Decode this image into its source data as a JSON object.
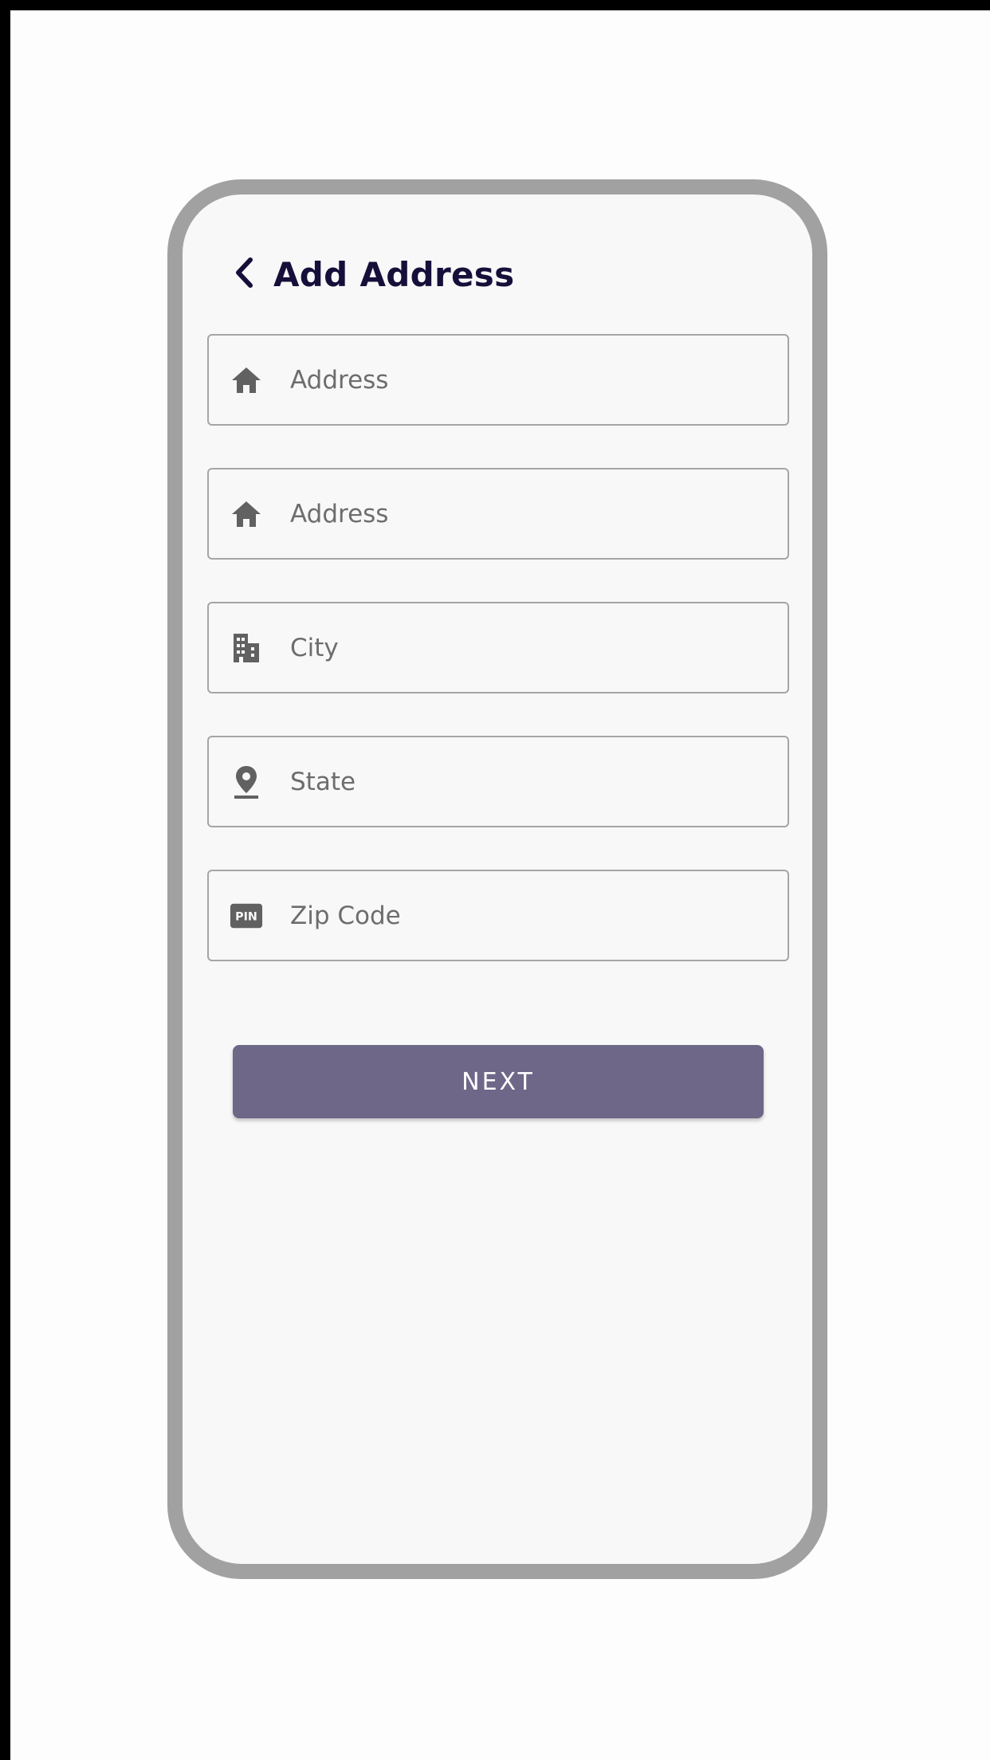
{
  "header": {
    "back_icon": "chevron-left-icon",
    "title": "Add Address"
  },
  "fields": [
    {
      "icon": "home-icon",
      "placeholder": "Address",
      "value": ""
    },
    {
      "icon": "home-icon",
      "placeholder": "Address",
      "value": ""
    },
    {
      "icon": "city-icon",
      "placeholder": "City",
      "value": ""
    },
    {
      "icon": "location-pin-icon",
      "placeholder": "State",
      "value": ""
    },
    {
      "icon": "pin-badge-icon",
      "placeholder": "Zip Code",
      "value": "",
      "icon_text": "PIN"
    }
  ],
  "next_button": {
    "label": "NEXT"
  },
  "colors": {
    "title": "#160f3a",
    "button": "#6e6788",
    "frame": "#a1a1a1",
    "icon": "#616161"
  }
}
